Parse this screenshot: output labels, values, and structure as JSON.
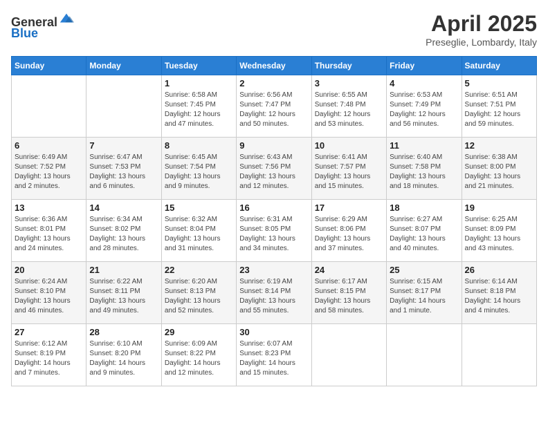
{
  "header": {
    "logo_general": "General",
    "logo_blue": "Blue",
    "month_title": "April 2025",
    "subtitle": "Preseglie, Lombardy, Italy"
  },
  "weekdays": [
    "Sunday",
    "Monday",
    "Tuesday",
    "Wednesday",
    "Thursday",
    "Friday",
    "Saturday"
  ],
  "weeks": [
    [
      {
        "day": null
      },
      {
        "day": null
      },
      {
        "day": "1",
        "sunrise": "Sunrise: 6:58 AM",
        "sunset": "Sunset: 7:45 PM",
        "daylight": "Daylight: 12 hours and 47 minutes."
      },
      {
        "day": "2",
        "sunrise": "Sunrise: 6:56 AM",
        "sunset": "Sunset: 7:47 PM",
        "daylight": "Daylight: 12 hours and 50 minutes."
      },
      {
        "day": "3",
        "sunrise": "Sunrise: 6:55 AM",
        "sunset": "Sunset: 7:48 PM",
        "daylight": "Daylight: 12 hours and 53 minutes."
      },
      {
        "day": "4",
        "sunrise": "Sunrise: 6:53 AM",
        "sunset": "Sunset: 7:49 PM",
        "daylight": "Daylight: 12 hours and 56 minutes."
      },
      {
        "day": "5",
        "sunrise": "Sunrise: 6:51 AM",
        "sunset": "Sunset: 7:51 PM",
        "daylight": "Daylight: 12 hours and 59 minutes."
      }
    ],
    [
      {
        "day": "6",
        "sunrise": "Sunrise: 6:49 AM",
        "sunset": "Sunset: 7:52 PM",
        "daylight": "Daylight: 13 hours and 2 minutes."
      },
      {
        "day": "7",
        "sunrise": "Sunrise: 6:47 AM",
        "sunset": "Sunset: 7:53 PM",
        "daylight": "Daylight: 13 hours and 6 minutes."
      },
      {
        "day": "8",
        "sunrise": "Sunrise: 6:45 AM",
        "sunset": "Sunset: 7:54 PM",
        "daylight": "Daylight: 13 hours and 9 minutes."
      },
      {
        "day": "9",
        "sunrise": "Sunrise: 6:43 AM",
        "sunset": "Sunset: 7:56 PM",
        "daylight": "Daylight: 13 hours and 12 minutes."
      },
      {
        "day": "10",
        "sunrise": "Sunrise: 6:41 AM",
        "sunset": "Sunset: 7:57 PM",
        "daylight": "Daylight: 13 hours and 15 minutes."
      },
      {
        "day": "11",
        "sunrise": "Sunrise: 6:40 AM",
        "sunset": "Sunset: 7:58 PM",
        "daylight": "Daylight: 13 hours and 18 minutes."
      },
      {
        "day": "12",
        "sunrise": "Sunrise: 6:38 AM",
        "sunset": "Sunset: 8:00 PM",
        "daylight": "Daylight: 13 hours and 21 minutes."
      }
    ],
    [
      {
        "day": "13",
        "sunrise": "Sunrise: 6:36 AM",
        "sunset": "Sunset: 8:01 PM",
        "daylight": "Daylight: 13 hours and 24 minutes."
      },
      {
        "day": "14",
        "sunrise": "Sunrise: 6:34 AM",
        "sunset": "Sunset: 8:02 PM",
        "daylight": "Daylight: 13 hours and 28 minutes."
      },
      {
        "day": "15",
        "sunrise": "Sunrise: 6:32 AM",
        "sunset": "Sunset: 8:04 PM",
        "daylight": "Daylight: 13 hours and 31 minutes."
      },
      {
        "day": "16",
        "sunrise": "Sunrise: 6:31 AM",
        "sunset": "Sunset: 8:05 PM",
        "daylight": "Daylight: 13 hours and 34 minutes."
      },
      {
        "day": "17",
        "sunrise": "Sunrise: 6:29 AM",
        "sunset": "Sunset: 8:06 PM",
        "daylight": "Daylight: 13 hours and 37 minutes."
      },
      {
        "day": "18",
        "sunrise": "Sunrise: 6:27 AM",
        "sunset": "Sunset: 8:07 PM",
        "daylight": "Daylight: 13 hours and 40 minutes."
      },
      {
        "day": "19",
        "sunrise": "Sunrise: 6:25 AM",
        "sunset": "Sunset: 8:09 PM",
        "daylight": "Daylight: 13 hours and 43 minutes."
      }
    ],
    [
      {
        "day": "20",
        "sunrise": "Sunrise: 6:24 AM",
        "sunset": "Sunset: 8:10 PM",
        "daylight": "Daylight: 13 hours and 46 minutes."
      },
      {
        "day": "21",
        "sunrise": "Sunrise: 6:22 AM",
        "sunset": "Sunset: 8:11 PM",
        "daylight": "Daylight: 13 hours and 49 minutes."
      },
      {
        "day": "22",
        "sunrise": "Sunrise: 6:20 AM",
        "sunset": "Sunset: 8:13 PM",
        "daylight": "Daylight: 13 hours and 52 minutes."
      },
      {
        "day": "23",
        "sunrise": "Sunrise: 6:19 AM",
        "sunset": "Sunset: 8:14 PM",
        "daylight": "Daylight: 13 hours and 55 minutes."
      },
      {
        "day": "24",
        "sunrise": "Sunrise: 6:17 AM",
        "sunset": "Sunset: 8:15 PM",
        "daylight": "Daylight: 13 hours and 58 minutes."
      },
      {
        "day": "25",
        "sunrise": "Sunrise: 6:15 AM",
        "sunset": "Sunset: 8:17 PM",
        "daylight": "Daylight: 14 hours and 1 minute."
      },
      {
        "day": "26",
        "sunrise": "Sunrise: 6:14 AM",
        "sunset": "Sunset: 8:18 PM",
        "daylight": "Daylight: 14 hours and 4 minutes."
      }
    ],
    [
      {
        "day": "27",
        "sunrise": "Sunrise: 6:12 AM",
        "sunset": "Sunset: 8:19 PM",
        "daylight": "Daylight: 14 hours and 7 minutes."
      },
      {
        "day": "28",
        "sunrise": "Sunrise: 6:10 AM",
        "sunset": "Sunset: 8:20 PM",
        "daylight": "Daylight: 14 hours and 9 minutes."
      },
      {
        "day": "29",
        "sunrise": "Sunrise: 6:09 AM",
        "sunset": "Sunset: 8:22 PM",
        "daylight": "Daylight: 14 hours and 12 minutes."
      },
      {
        "day": "30",
        "sunrise": "Sunrise: 6:07 AM",
        "sunset": "Sunset: 8:23 PM",
        "daylight": "Daylight: 14 hours and 15 minutes."
      },
      {
        "day": null
      },
      {
        "day": null
      },
      {
        "day": null
      }
    ]
  ]
}
